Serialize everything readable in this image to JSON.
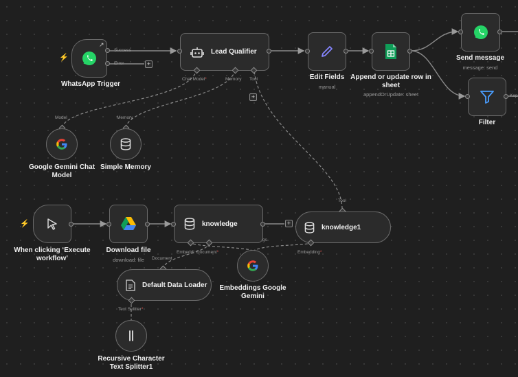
{
  "nodes": {
    "whatsapp_trigger": {
      "title": "WhatsApp Trigger",
      "out_success": "Success",
      "out_error": "Error"
    },
    "lead_qualifier": {
      "title": "Lead Qualifier",
      "in_chat_model": "Chat Model",
      "in_memory": "Memory",
      "in_tool": "Tool"
    },
    "edit_fields": {
      "title": "Edit Fields",
      "subtitle": "manual"
    },
    "sheets": {
      "title_line1": "Append or update row in",
      "title_line2": "sheet",
      "subtitle": "appendOrUpdate: sheet"
    },
    "send_message": {
      "title": "Send message",
      "subtitle": "message: send"
    },
    "filter": {
      "title": "Filter",
      "out_kept": "Kep"
    },
    "gemini_chat": {
      "title_line1": "Google Gemini Chat",
      "title_line2": "Model",
      "port": "Model"
    },
    "simple_memory": {
      "title": "Simple Memory",
      "port": "Memory"
    },
    "manual_trigger": {
      "title_line1": "When clicking ‘Execute",
      "title_line2": "workflow’"
    },
    "download_file": {
      "title": "Download file",
      "subtitle": "download: file"
    },
    "knowledge": {
      "title": "knowledge",
      "in_embedding": "Embeddi",
      "in_document": "Document",
      "overlap": "gs"
    },
    "knowledge1": {
      "title": "knowledge1",
      "port_tool": "Tool",
      "in_embedding": "Embedding"
    },
    "embeddings_gemini": {
      "title_line1": "Embeddings Google",
      "title_line2": "Gemini"
    },
    "default_loader": {
      "title": "Default Data Loader",
      "port_document": "Document",
      "in_splitter": "Text Splitter"
    },
    "text_splitter": {
      "title_line1": "Recursive Character",
      "title_line2": "Text Splitter1"
    }
  },
  "colors": {
    "canvas": "#1f1f1f",
    "node_fill": "#2b2b2b",
    "node_border": "#6a6a6a",
    "edge": "#8a8a8a",
    "trigger_bolt": "#ff6d5a",
    "required": "#e0524e",
    "whatsapp": "#25d366",
    "sheets": "#0f9d58",
    "edit_fields": "#7b7bff",
    "filter": "#4a9eff"
  },
  "icons": {
    "whatsapp_trigger": "whatsapp-icon",
    "lead_qualifier": "robot-icon",
    "edit_fields": "pencil-icon",
    "sheets": "google-sheets-icon",
    "send_message": "whatsapp-icon",
    "filter": "filter-icon",
    "gemini_chat": "google-icon",
    "simple_memory": "database-icon",
    "manual_trigger": "cursor-icon",
    "download_file": "google-drive-icon",
    "knowledge": "database-icon",
    "knowledge1": "database-icon",
    "embeddings_gemini": "google-icon",
    "default_loader": "document-icon",
    "text_splitter": "split-icon"
  }
}
